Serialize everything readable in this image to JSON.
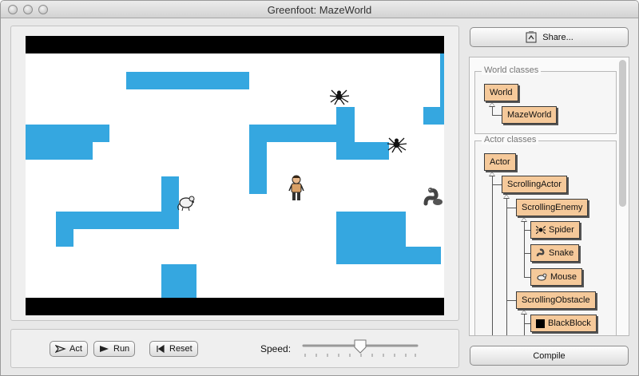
{
  "window": {
    "title": "Greenfoot: MazeWorld"
  },
  "world": {
    "colors": {
      "wall": "#35a7e0",
      "border_bar": "#000000",
      "background": "#ffffff"
    },
    "actors": [
      "spider",
      "spider",
      "mouse",
      "player",
      "snake"
    ]
  },
  "controls": {
    "act_label": "Act",
    "run_label": "Run",
    "reset_label": "Reset",
    "speed_label": "Speed:",
    "speed_value": 0.5
  },
  "sidebar": {
    "share_label": "Share...",
    "world_classes_title": "World classes",
    "world_classes": {
      "base": "World",
      "sub": "MazeWorld"
    },
    "actor_classes_title": "Actor classes",
    "actor_classes": {
      "actor": "Actor",
      "scrolling_actor": "ScrollingActor",
      "scrolling_enemy": "ScrollingEnemy",
      "spider": "Spider",
      "snake": "Snake",
      "mouse": "Mouse",
      "scrolling_obstacle": "ScrollingObstacle",
      "black_block": "BlackBlock"
    },
    "compile_label": "Compile",
    "class_color": "#f5c99a"
  }
}
